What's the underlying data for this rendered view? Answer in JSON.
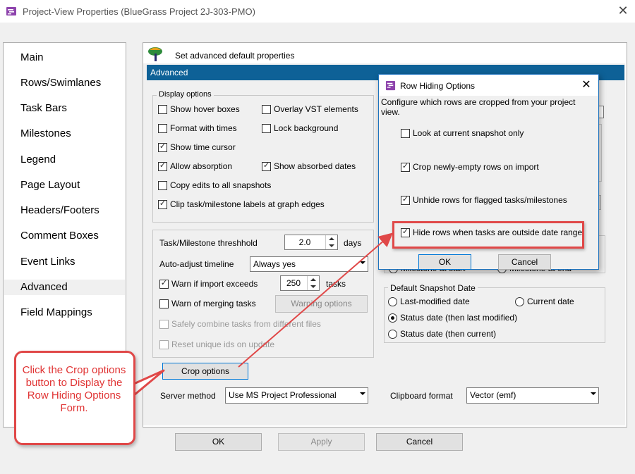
{
  "window": {
    "title": "Project-View Properties (BlueGrass Project 2J-303-PMO)"
  },
  "nav": {
    "items": [
      "Main",
      "Rows/Swimlanes",
      "Task Bars",
      "Milestones",
      "Legend",
      "Page Layout",
      "Headers/Footers",
      "Comment Boxes",
      "Event Links",
      "Advanced",
      "Field Mappings"
    ],
    "selected": "Advanced"
  },
  "header": {
    "text": "Set advanced default properties",
    "section": "Advanced"
  },
  "display_options": {
    "label": "Display options",
    "show_hover_boxes": "Show hover boxes",
    "overlay_vst": "Overlay VST elements",
    "format_with_times": "Format with times",
    "lock_background": "Lock background",
    "show_time_cursor": "Show time cursor",
    "allow_absorption": "Allow absorption",
    "show_absorbed_dates": "Show absorbed dates",
    "copy_edits": "Copy edits to all snapshots",
    "clip_labels": "Clip task/milestone labels at graph edges"
  },
  "threshold": {
    "label": "Task/Milestone threshhold",
    "value": "2.0",
    "unit": "days"
  },
  "auto_adjust": {
    "label": "Auto-adjust timeline",
    "value": "Always yes"
  },
  "warn_import": {
    "label": "Warn if import exceeds",
    "value": "250",
    "unit": "tasks"
  },
  "warn_merging": {
    "label": "Warn of merging tasks",
    "button": "Warning options"
  },
  "safely_combine": "Safely combine tasks from different files",
  "reset_ids": "Reset unique ids on update",
  "crop_button": "Crop options",
  "milestone_at_start": "Milestone at start",
  "milestone_at_end": "Milestone at end",
  "snapshot_date": {
    "label": "Default Snapshot Date",
    "last_modified": "Last-modified date",
    "current_date": "Current date",
    "status_then_last": "Status date (then last modified)",
    "status_then_current": "Status date (then current)"
  },
  "server_method": {
    "label": "Server method",
    "value": "Use MS Project Professional"
  },
  "clipboard_format": {
    "label": "Clipboard format",
    "value": "Vector (emf)"
  },
  "footer": {
    "ok": "OK",
    "apply": "Apply",
    "cancel": "Cancel"
  },
  "row_hiding_dialog": {
    "title": "Row Hiding Options",
    "description": "Configure which rows are cropped from your project view.",
    "look_at_current": "Look at current snapshot only",
    "crop_newly_empty": "Crop newly-empty rows on import",
    "unhide_flagged": "Unhide rows for flagged tasks/milestones",
    "hide_outside_range": "Hide rows when tasks are outside date range",
    "ok": "OK",
    "cancel": "Cancel"
  },
  "annotation": {
    "text": "Click the Crop options button to Display the Row Hiding Options Form."
  },
  "colors": {
    "accent": "#0e6197",
    "annotation": "#e04848"
  }
}
